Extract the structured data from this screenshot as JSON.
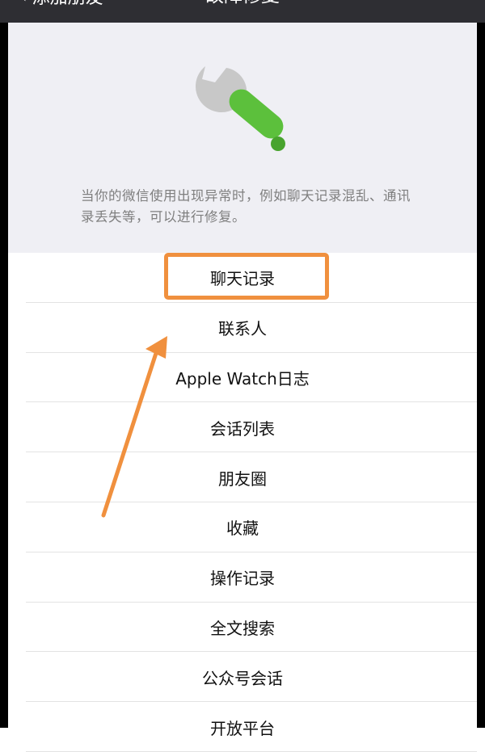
{
  "navbar": {
    "back_label": "添加朋友",
    "title": "故障修复"
  },
  "header": {
    "icon": "wrench-icon",
    "description": "当你的微信使用出现异常时，例如聊天记录混乱、通讯录丢失等，可以进行修复。"
  },
  "repair_items": [
    {
      "label": "聊天记录"
    },
    {
      "label": "联系人"
    },
    {
      "label": "Apple Watch日志"
    },
    {
      "label": "会话列表"
    },
    {
      "label": "朋友圈"
    },
    {
      "label": "收藏"
    },
    {
      "label": "操作记录"
    },
    {
      "label": "全文搜索"
    },
    {
      "label": "公众号会话"
    },
    {
      "label": "开放平台"
    }
  ],
  "colors": {
    "highlight": "#f0903e",
    "wrench_handle": "#5cc03c",
    "wrench_head": "#c8c8c8"
  }
}
